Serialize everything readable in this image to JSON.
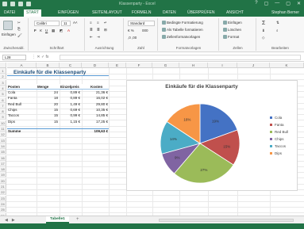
{
  "window": {
    "title": "Klassenparty - Excel",
    "controls": [
      "?",
      "▢",
      "—",
      "▢",
      "✕"
    ]
  },
  "ribbon_tabs": [
    {
      "label": "DATEI",
      "active": false
    },
    {
      "label": "START",
      "active": true
    },
    {
      "label": "EINFÜGEN",
      "active": false
    },
    {
      "label": "SEITENLAYOUT",
      "active": false
    },
    {
      "label": "FORMELN",
      "active": false
    },
    {
      "label": "DATEN",
      "active": false
    },
    {
      "label": "ÜBERPRÜFEN",
      "active": false
    },
    {
      "label": "ANSICHT",
      "active": false
    }
  ],
  "user": "Stephan Berner",
  "ribbon": {
    "clipboard": {
      "paste": "Einfügen",
      "label": "Zwischenabl."
    },
    "font": {
      "name": "Calibri",
      "size": "11",
      "label": "Schriftart",
      "bold": "F",
      "italic": "K",
      "underline": "U"
    },
    "alignment": {
      "label": "Ausrichtung"
    },
    "number": {
      "format": "Standard",
      "label": "Zahl"
    },
    "styles": {
      "conditional": "Bedingte Formatierung",
      "as_table": "Als Tabelle formatieren",
      "cell_styles": "Zellenformatvorlagen",
      "label": "Formatvorlagen"
    },
    "cells": {
      "insert": "Einfügen",
      "delete": "Löschen",
      "format": "Format",
      "label": "Zellen"
    },
    "editing": {
      "label": "Bearbeiten"
    }
  },
  "formula_bar": {
    "name_box": "L28",
    "value": ""
  },
  "columns": [
    "A",
    "B",
    "C",
    "D",
    "E",
    "F",
    "G",
    "H",
    "I",
    "J",
    "K"
  ],
  "rows": [
    "1",
    "2",
    "3",
    "4",
    "5",
    "6",
    "7",
    "8",
    "9",
    "10",
    "11",
    "12",
    "13",
    "14",
    "15",
    "16",
    "17",
    "18",
    "19",
    "20",
    "21",
    "22",
    "23",
    "24",
    "25",
    "26"
  ],
  "sheet": {
    "title": "Einkäufe für die Klassenparty",
    "headers": [
      "Posten",
      "Menge",
      "Einzelpreis",
      "Kosten"
    ],
    "items": [
      {
        "posten": "Cola",
        "menge": "24",
        "preis": "0,89 €",
        "kosten": "21,36 €"
      },
      {
        "posten": "Fanta",
        "menge": "18",
        "preis": "0,89 €",
        "kosten": "16,02 €"
      },
      {
        "posten": "Red Bull",
        "menge": "20",
        "preis": "1,49 €",
        "kosten": "29,80 €"
      },
      {
        "posten": "Chips",
        "menge": "15",
        "preis": "0,69 €",
        "kosten": "10,35 €"
      },
      {
        "posten": "Taccos",
        "menge": "15",
        "preis": "0,99 €",
        "kosten": "14,85 €"
      },
      {
        "posten": "Dips",
        "menge": "15",
        "preis": "1,15 €",
        "kosten": "17,25 €"
      }
    ],
    "sum_label": "Summe",
    "sum_value": "109,63 €"
  },
  "chart_data": {
    "type": "pie",
    "title": "Einkäufe für die Klassenparty",
    "categories": [
      "Cola",
      "Fanta",
      "Red Bull",
      "Chips",
      "Taccos",
      "Dips"
    ],
    "values": [
      21.36,
      16.02,
      29.8,
      10.35,
      14.85,
      17.25
    ],
    "data_labels": [
      "19%",
      "15%",
      "27%",
      "9%",
      "14%",
      "16%"
    ],
    "colors": [
      "#4472c4",
      "#c0504d",
      "#9bbb59",
      "#8064a2",
      "#4bacc6",
      "#f79646"
    ],
    "legend_position": "right"
  },
  "sheet_tabs": [
    {
      "label": "Tabelle1",
      "active": true
    }
  ],
  "add_sheet": "+"
}
